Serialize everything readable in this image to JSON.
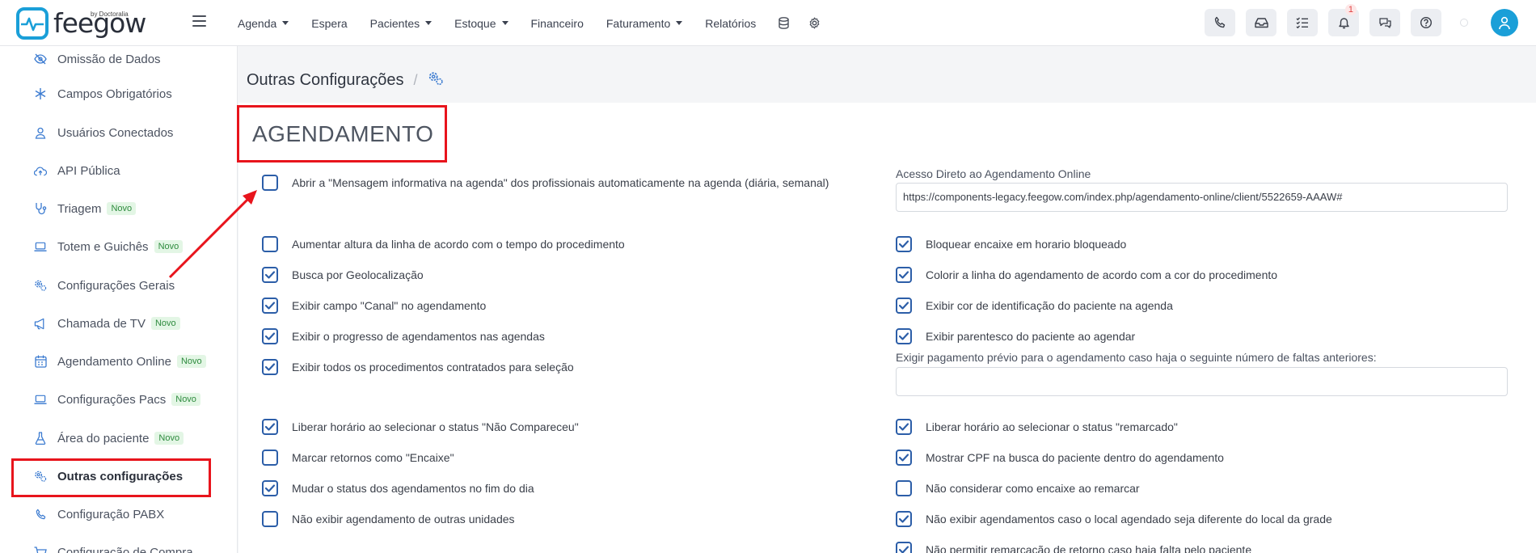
{
  "brand": {
    "name": "feegow",
    "by": "by Doctoralia",
    "color": "#1a9fd8"
  },
  "nav": {
    "items": [
      {
        "label": "Agenda",
        "dropdown": true
      },
      {
        "label": "Espera",
        "dropdown": false
      },
      {
        "label": "Pacientes",
        "dropdown": true
      },
      {
        "label": "Estoque",
        "dropdown": true
      },
      {
        "label": "Financeiro",
        "dropdown": false
      },
      {
        "label": "Faturamento",
        "dropdown": true
      },
      {
        "label": "Relatórios",
        "dropdown": false
      }
    ],
    "notification_count": "1"
  },
  "sidebar": {
    "items": [
      {
        "label": "Omissão de Dados",
        "icon": "eye-slash-icon"
      },
      {
        "label": "Campos Obrigatórios",
        "icon": "asterisk-icon"
      },
      {
        "label": "Usuários Conectados",
        "icon": "user-icon"
      },
      {
        "label": "API Pública",
        "icon": "cloud-upload-icon"
      },
      {
        "label": "Triagem",
        "icon": "stethoscope-icon",
        "badge": "Novo"
      },
      {
        "label": "Totem e Guichês",
        "icon": "laptop-icon",
        "badge": "Novo"
      },
      {
        "label": "Configurações Gerais",
        "icon": "gears-icon"
      },
      {
        "label": "Chamada de TV",
        "icon": "megaphone-icon",
        "badge": "Novo"
      },
      {
        "label": "Agendamento Online",
        "icon": "calendar-icon",
        "badge": "Novo"
      },
      {
        "label": "Configurações Pacs",
        "icon": "laptop-icon",
        "badge": "Novo"
      },
      {
        "label": "Área do paciente",
        "icon": "flask-icon",
        "badge": "Novo"
      },
      {
        "label": "Outras configurações",
        "icon": "gears-icon",
        "active": true
      },
      {
        "label": "Configuração PABX",
        "icon": "phone-icon"
      },
      {
        "label": "Configuração de Compra",
        "icon": "cart-icon"
      }
    ]
  },
  "breadcrumb": {
    "title": "Outras Configurações",
    "separator": "/"
  },
  "section": {
    "title": "AGENDAMENTO"
  },
  "left_options": [
    {
      "label": "Abrir a \"Mensagem informativa na agenda\" dos profissionais automaticamente na agenda (diária, semanal)",
      "checked": false
    },
    {
      "label": "Aumentar altura da linha de acordo com o tempo do procedimento",
      "checked": false
    },
    {
      "label": "Busca por Geolocalização",
      "checked": true
    },
    {
      "label": "Exibir campo \"Canal\" no agendamento",
      "checked": true
    },
    {
      "label": "Exibir o progresso de agendamentos nas agendas",
      "checked": true
    },
    {
      "label": "Exibir todos os procedimentos contratados para seleção",
      "checked": true
    },
    {
      "label": "Liberar horário ao selecionar o status \"Não Compareceu\"",
      "checked": true
    },
    {
      "label": "Marcar retornos como \"Encaixe\"",
      "checked": false
    },
    {
      "label": "Mudar o status dos agendamentos no fim do dia",
      "checked": true
    },
    {
      "label": "Não exibir agendamento de outras unidades",
      "checked": false
    }
  ],
  "online_access": {
    "label": "Acesso Direto ao Agendamento Online",
    "value": "https://components-legacy.feegow.com/index.php/agendamento-online/client/5522659-AAAW#"
  },
  "right_options": [
    {
      "label": "Bloquear encaixe em horario bloqueado",
      "checked": true
    },
    {
      "label": "Colorir a linha do agendamento de acordo com a cor do procedimento",
      "checked": true
    },
    {
      "label": "Exibir cor de identificação do paciente na agenda",
      "checked": true
    },
    {
      "label": "Exibir parentesco do paciente ao agendar",
      "checked": true
    },
    {
      "label": "Liberar horário ao selecionar o status \"remarcado\"",
      "checked": true
    },
    {
      "label": "Mostrar CPF na busca do paciente dentro do agendamento",
      "checked": true
    },
    {
      "label": "Não considerar como encaixe ao remarcar",
      "checked": false
    },
    {
      "label": "Não exibir agendamentos caso o local agendado seja diferente do local da grade",
      "checked": true
    },
    {
      "label": "Não permitir remarcação de retorno caso haja falta pelo paciente",
      "checked": true
    }
  ],
  "prepayment": {
    "label": "Exigir pagamento prévio para o agendamento caso haja o seguinte número de faltas anteriores:",
    "value": ""
  }
}
